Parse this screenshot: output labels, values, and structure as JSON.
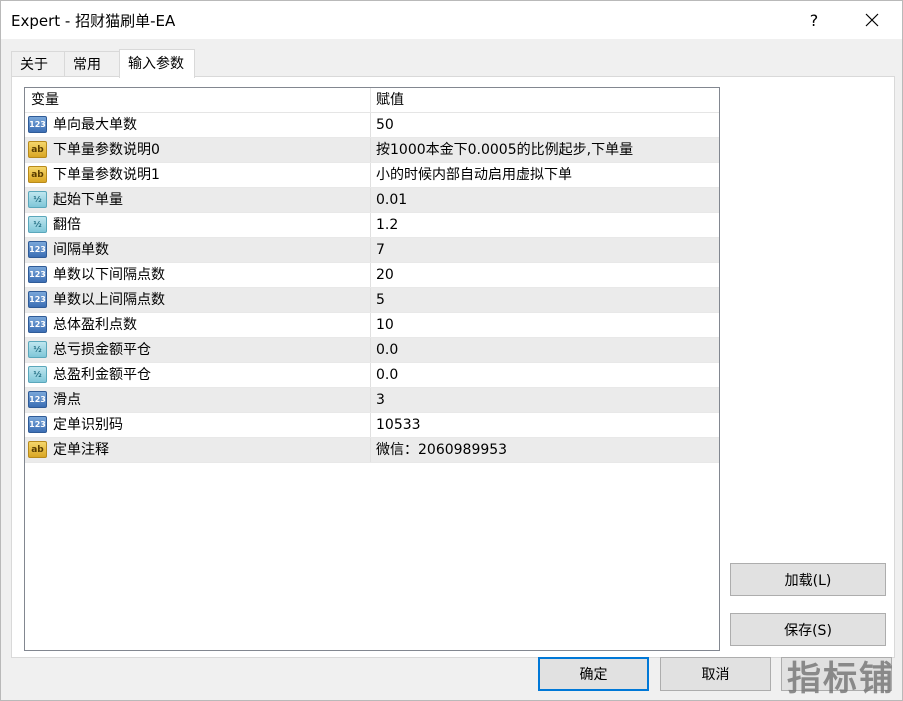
{
  "window": {
    "title": "Expert - 招财猫刷单-EA",
    "help_label": "?"
  },
  "tabs": [
    {
      "label": "关于"
    },
    {
      "label": "常用"
    },
    {
      "label": "输入参数"
    }
  ],
  "grid": {
    "header": {
      "variable": "变量",
      "value": "赋值"
    },
    "rows": [
      {
        "type": "int",
        "icon": "123",
        "name": "单向最大单数",
        "value": "50"
      },
      {
        "type": "string",
        "icon": "ab",
        "name": "下单量参数说明0",
        "value": "按1000本金下0.0005的比例起步,下单量"
      },
      {
        "type": "string",
        "icon": "ab",
        "name": "下单量参数说明1",
        "value": "小的时候内部自动启用虚拟下单"
      },
      {
        "type": "double",
        "icon": "½",
        "name": "起始下单量",
        "value": "0.01"
      },
      {
        "type": "double",
        "icon": "½",
        "name": "翻倍",
        "value": "1.2"
      },
      {
        "type": "int",
        "icon": "123",
        "name": "间隔单数",
        "value": "7"
      },
      {
        "type": "int",
        "icon": "123",
        "name": "单数以下间隔点数",
        "value": "20"
      },
      {
        "type": "int",
        "icon": "123",
        "name": "单数以上间隔点数",
        "value": "5"
      },
      {
        "type": "int",
        "icon": "123",
        "name": "总体盈利点数",
        "value": "10"
      },
      {
        "type": "double",
        "icon": "½",
        "name": "总亏损金额平仓",
        "value": "0.0"
      },
      {
        "type": "double",
        "icon": "½",
        "name": "总盈利金额平仓",
        "value": "0.0"
      },
      {
        "type": "int",
        "icon": "123",
        "name": "滑点",
        "value": "3"
      },
      {
        "type": "int",
        "icon": "123",
        "name": "定单识别码",
        "value": "10533"
      },
      {
        "type": "string",
        "icon": "ab",
        "name": "定单注释",
        "value": "微信：2060989953"
      }
    ]
  },
  "buttons": {
    "load": "加载(L)",
    "save": "保存(S)",
    "ok": "确定",
    "cancel": "取消",
    "reset": ""
  },
  "watermark": "指标铺"
}
